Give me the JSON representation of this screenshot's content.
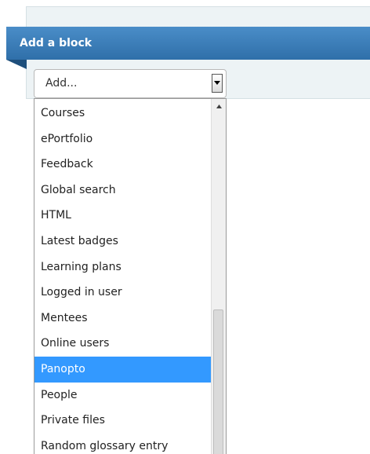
{
  "block": {
    "title": "Add a block"
  },
  "select": {
    "value": "Add...",
    "arrow_icon": "chevron-down-icon"
  },
  "dropdown": {
    "options": [
      "Courses",
      "ePortfolio",
      "Feedback",
      "Global search",
      "HTML",
      "Latest badges",
      "Learning plans",
      "Logged in user",
      "Mentees",
      "Online users",
      "Panopto",
      "People",
      "Private files",
      "Random glossary entry"
    ],
    "selected": "Panopto"
  },
  "colors": {
    "header_blue": "#3b7fbb",
    "selection_blue": "#3399ff",
    "panel_bg": "#edf3f5"
  }
}
